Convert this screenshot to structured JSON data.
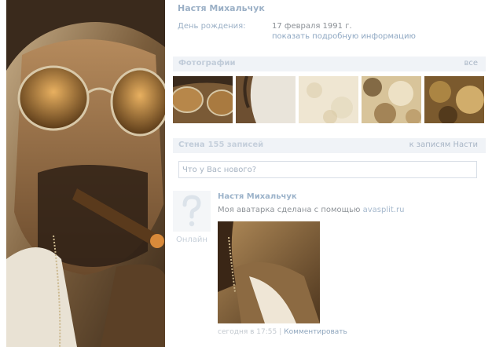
{
  "profile": {
    "name": "Настя Михальчук",
    "birthday_label": "День рождения:",
    "birthday_value": "17 февраля 1991 г.",
    "more_info_link": "показать подробную информацию"
  },
  "photos": {
    "title": "Фотографии",
    "all_link": "все"
  },
  "wall": {
    "title": "Стена",
    "count": "155 записей",
    "to_notes_link": "к записям Насти",
    "input_placeholder": "Что у Вас нового?"
  },
  "post": {
    "author": "Настя Михальчук",
    "text": "Моя аватарка сделана с помощью",
    "link": "avasplit.ru",
    "status": "Онлайн",
    "time": "сегодня в 17:55",
    "separator": "|",
    "comment_link": "Комментировать"
  },
  "colors": {
    "link_blue": "#8ea7c2",
    "section_bg": "#f0f3f7",
    "photo_sepia": "#6b5338"
  },
  "icons": {
    "post_avatar": "question-mark-icon"
  }
}
